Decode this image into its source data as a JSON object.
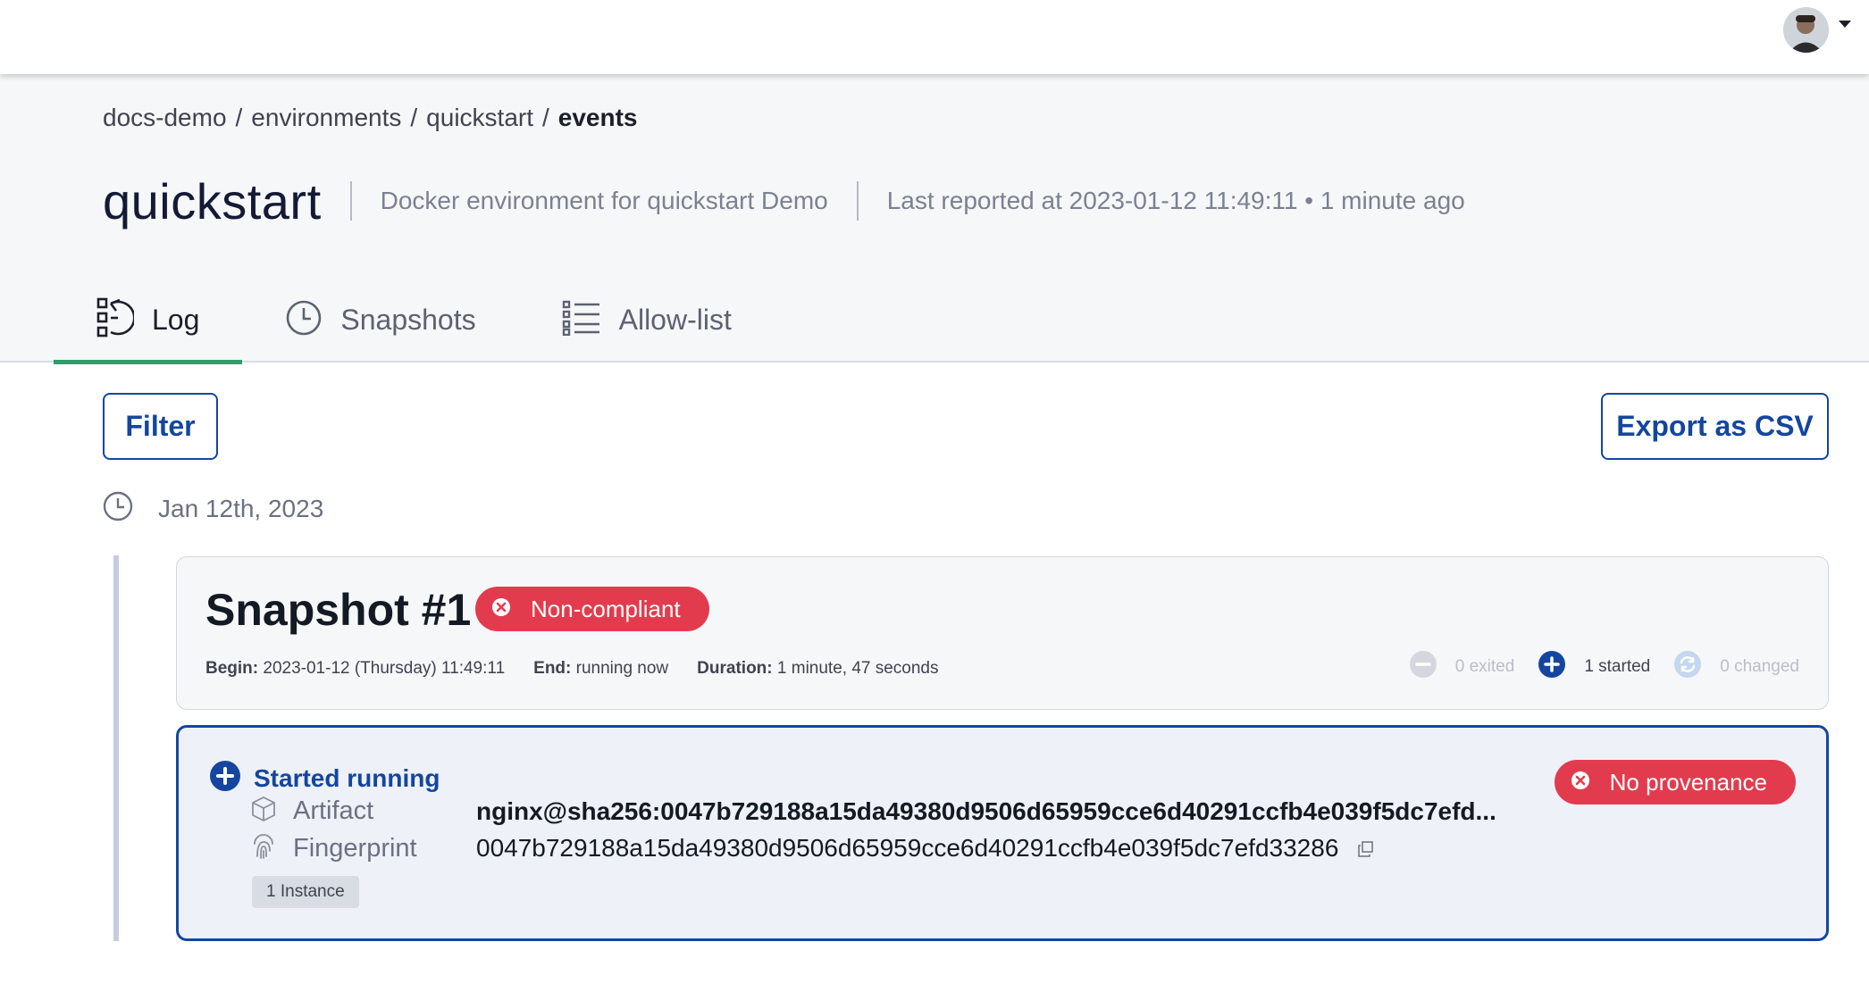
{
  "breadcrumb": {
    "items": [
      "docs-demo",
      "environments",
      "quickstart"
    ],
    "separator": "/",
    "current": "events"
  },
  "header": {
    "title": "quickstart",
    "description": "Docker environment for quickstart Demo",
    "last_reported": "Last reported at 2023-01-12 11:49:11 • 1 minute ago"
  },
  "tabs": [
    {
      "label": "Log",
      "icon": "log-icon",
      "active": true
    },
    {
      "label": "Snapshots",
      "icon": "clock-icon",
      "active": false
    },
    {
      "label": "Allow-list",
      "icon": "list-icon",
      "active": false
    }
  ],
  "toolbar": {
    "filter_label": "Filter",
    "export_label": "Export as CSV"
  },
  "timeline": {
    "date": "Jan 12th, 2023"
  },
  "snapshot": {
    "title": "Snapshot #1",
    "status": "Non-compliant",
    "begin_label": "Begin:",
    "begin_value": "2023-01-12 (Thursday) 11:49:11",
    "end_label": "End:",
    "end_value": "running now",
    "duration_label": "Duration:",
    "duration_value": "1 minute, 47 seconds",
    "exited": "0 exited",
    "started": "1 started",
    "changed": "0 changed"
  },
  "event": {
    "title": "Started running",
    "badge": "No provenance",
    "artifact_label": "Artifact",
    "artifact_value": "nginx@sha256:0047b729188a15da49380d9506d65959cce6d40291ccfb4e039f5dc7efd...",
    "fingerprint_label": "Fingerprint",
    "fingerprint_value": "0047b729188a15da49380d9506d65959cce6d40291ccfb4e039f5dc7efd33286",
    "instances": "1 Instance"
  },
  "colors": {
    "accent_blue": "#1446a0",
    "danger_red": "#e33b4e",
    "active_tab_green": "#2e9e6a",
    "muted_gray": "#b9bec8"
  }
}
